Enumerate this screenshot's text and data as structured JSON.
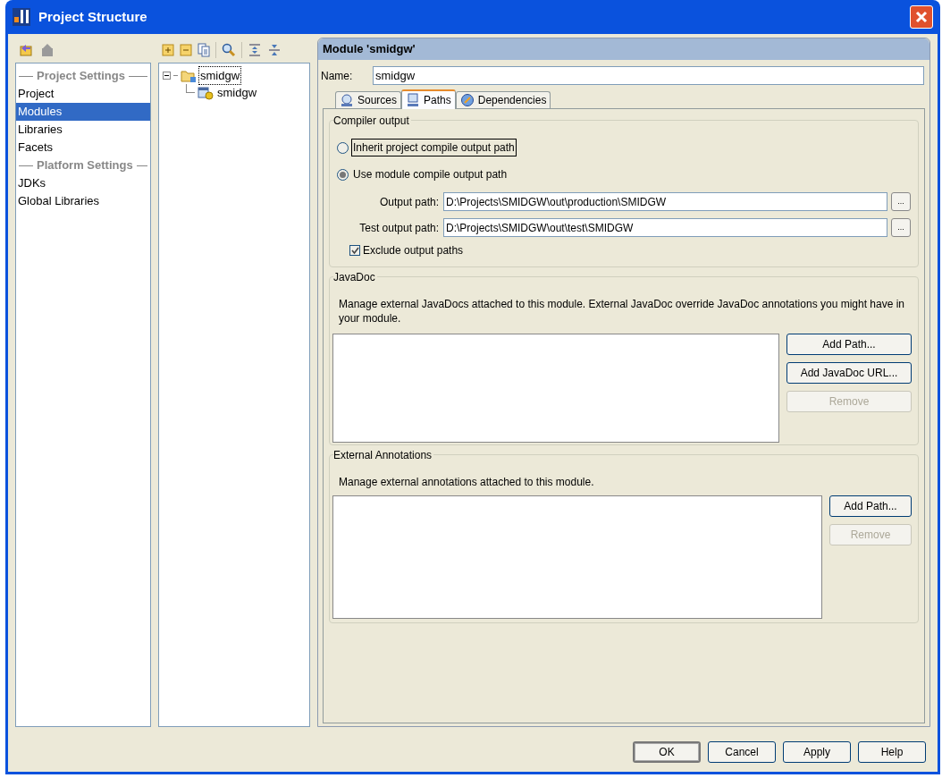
{
  "window": {
    "title": "Project Structure"
  },
  "sidebar": {
    "items": [
      {
        "kind": "header",
        "label": "Project Settings"
      },
      {
        "kind": "item",
        "label": "Project",
        "selected": false
      },
      {
        "kind": "item",
        "label": "Modules",
        "selected": true
      },
      {
        "kind": "item",
        "label": "Libraries",
        "selected": false
      },
      {
        "kind": "item",
        "label": "Facets",
        "selected": false
      },
      {
        "kind": "header",
        "label": "Platform Settings"
      },
      {
        "kind": "item",
        "label": "JDKs",
        "selected": false
      },
      {
        "kind": "item",
        "label": "Global Libraries",
        "selected": false
      }
    ]
  },
  "tree": {
    "items": [
      {
        "label": "smidgw",
        "focused": true,
        "expanded": true,
        "children": [
          {
            "label": "smidgw",
            "focused": false
          }
        ]
      }
    ]
  },
  "module_panel": {
    "title": "Module 'smidgw'",
    "name_label": "Name:",
    "name_value": "smidgw",
    "tabs": [
      {
        "label": "Sources",
        "selected": false
      },
      {
        "label": "Paths",
        "selected": true
      },
      {
        "label": "Dependencies",
        "selected": false
      }
    ],
    "compiler_output": {
      "title": "Compiler output",
      "options": [
        {
          "label": "Inherit project compile output path",
          "selected": false,
          "focused": true
        },
        {
          "label": "Use module compile output path",
          "selected": true,
          "focused": false
        }
      ],
      "paths": [
        {
          "label": "Output path:",
          "value": "D:\\Projects\\SMIDGW\\out\\production\\SMIDGW",
          "button": "..."
        },
        {
          "label": "Test output path:",
          "value": "D:\\Projects\\SMIDGW\\out\\test\\SMIDGW",
          "button": "..."
        }
      ],
      "exclude": {
        "label": "Exclude output paths",
        "checked": true
      }
    },
    "javadoc": {
      "title": "JavaDoc",
      "description": "Manage external JavaDocs attached to this module. External JavaDoc override JavaDoc annotations you might have in your module.",
      "buttons": [
        {
          "label": "Add Path...",
          "disabled": false
        },
        {
          "label": "Add JavaDoc URL...",
          "disabled": false
        },
        {
          "label": "Remove",
          "disabled": true
        }
      ]
    },
    "annotations": {
      "title": "External Annotations",
      "description": "Manage external annotations attached to this module.",
      "buttons": [
        {
          "label": "Add Path...",
          "disabled": false
        },
        {
          "label": "Remove",
          "disabled": true
        }
      ]
    }
  },
  "buttons": [
    {
      "label": "OK",
      "default": true
    },
    {
      "label": "Cancel",
      "default": false
    },
    {
      "label": "Apply",
      "default": false
    },
    {
      "label": "Help",
      "default": false
    }
  ]
}
